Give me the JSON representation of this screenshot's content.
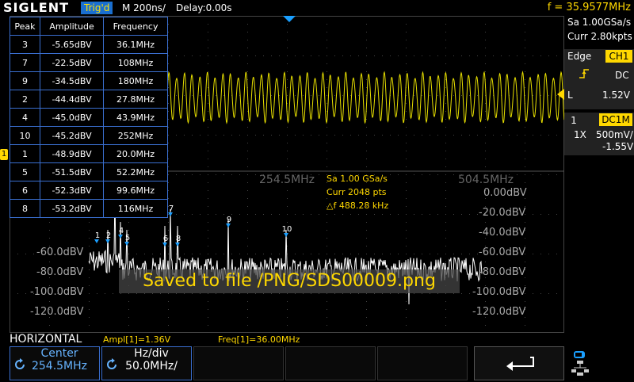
{
  "topbar": {
    "brand": "SIGLENT",
    "trigger_status": "Trig'd",
    "timebase": "M 200ns/",
    "delay": "Delay:0.00s",
    "frequency": "f = 35.9577MHz"
  },
  "peak_table": {
    "headers": [
      "Peak",
      "Amplitude",
      "Frequency"
    ],
    "rows": [
      [
        "3",
        "-5.65dBV",
        "36.1MHz"
      ],
      [
        "7",
        "-22.5dBV",
        "108MHz"
      ],
      [
        "9",
        "-34.5dBV",
        "180MHz"
      ],
      [
        "2",
        "-44.4dBV",
        "27.8MHz"
      ],
      [
        "4",
        "-45.0dBV",
        "43.9MHz"
      ],
      [
        "10",
        "-45.2dBV",
        "252MHz"
      ],
      [
        "1",
        "-48.9dBV",
        "20.0MHz"
      ],
      [
        "5",
        "-51.5dBV",
        "52.2MHz"
      ],
      [
        "6",
        "-52.3dBV",
        "99.6MHz"
      ],
      [
        "8",
        "-53.2dBV",
        "116MHz"
      ]
    ]
  },
  "right_panel": {
    "sample_rate": "Sa 1.00GSa/s",
    "curr": "Curr 2.80kpts",
    "trigger_type": "Edge",
    "trigger_source": "CH1",
    "coupling": "DC",
    "level_label": "L",
    "level": "1.52V",
    "channel_number": "1",
    "channel_coupling": "DC1M",
    "probe": "1X",
    "volts_div": "500mV/",
    "offset": "-1.55V"
  },
  "fft": {
    "freq_marker_left": "254.5MHz",
    "freq_marker_right": "504.5MHz",
    "sa": "Sa 1.00 GSa/s",
    "curr": "Curr 2048 pts",
    "delta_f": "△f 488.28 kHz",
    "y_labels": [
      "0.00dBV",
      "-20.0dBV",
      "-40.0dBV",
      "-60.0dBV",
      "-80.0dBV",
      "-100.0dBV",
      "-120.0dBV"
    ],
    "y_labels_left": [
      "-60.0dBV",
      "-80.0dBV",
      "-100.0dBV",
      "-120.0dBV"
    ],
    "peak_marker_labels": [
      "1",
      "2",
      "3",
      "4",
      "5",
      "6",
      "7",
      "8",
      "9",
      "10"
    ],
    "saved_message": "Saved to file /PNG/SDS00009.png"
  },
  "bottom": {
    "horizontal_label": "HORIZONTAL",
    "ampl": "Ampl[1]=1.36V",
    "freq": "Freq[1]=36.00MHz",
    "center_title": "Center",
    "center_value": "254.5MHz",
    "hzdiv_title": "Hz/div",
    "hzdiv_value": "50.0MHz/"
  },
  "icons": {
    "back": "return-arrow-icon",
    "network": "network-icon",
    "knob": "rotary-knob-icon"
  },
  "colors": {
    "ch1": "#ffd800",
    "accent": "#3a6fd0",
    "grid": "#333333"
  }
}
